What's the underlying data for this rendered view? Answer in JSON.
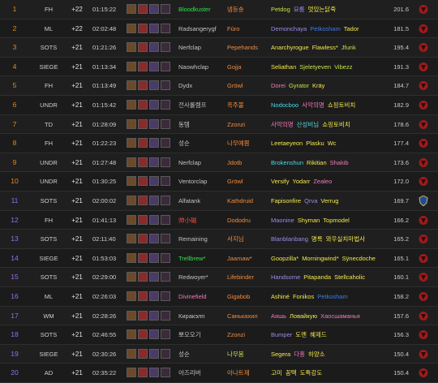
{
  "board": {
    "rows": [
      {
        "rank": "1",
        "rank_color": "#e78a1f",
        "dungeon": "FH",
        "level": "+22",
        "time": "01:15:22",
        "players": [
          {
            "name": "Bloodkuster",
            "color": "#2ee34b"
          },
          {
            "name": "넴등송",
            "color": "#f28a3c"
          },
          {
            "name": "Petdog",
            "color": "#c2e24a"
          },
          {
            "name": "묘룸",
            "color": "#9c8bea"
          },
          {
            "name": "멋있는닭죽",
            "color": "#f3e84a"
          }
        ],
        "score": "201.6",
        "faction": "horde"
      },
      {
        "rank": "2",
        "rank_color": "#e78a1f",
        "dungeon": "ML",
        "level": "+22",
        "time": "02:02:48",
        "players": [
          {
            "name": "Radsangerygf",
            "color": "#c2c2c2"
          },
          {
            "name": "Fúro",
            "color": "#f28a3c"
          },
          {
            "name": "Demonchaya",
            "color": "#9c8bea"
          },
          {
            "name": "Petkosham",
            "color": "#3d7be8"
          },
          {
            "name": "Tador",
            "color": "#f3e84a"
          }
        ],
        "score": "181.5",
        "faction": "horde"
      },
      {
        "rank": "3",
        "rank_color": "#e78a1f",
        "dungeon": "SOTS",
        "level": "+21",
        "time": "01:21:26",
        "players": [
          {
            "name": "Nerfclap",
            "color": "#c2c2c2"
          },
          {
            "name": "Pepehands",
            "color": "#f28a3c"
          },
          {
            "name": "Anarchyrogue",
            "color": "#f3e84a"
          },
          {
            "name": "Flawless*",
            "color": "#f3e84a"
          },
          {
            "name": "Jfunk",
            "color": "#c2e24a"
          }
        ],
        "score": "195.4",
        "faction": "horde"
      },
      {
        "rank": "4",
        "rank_color": "#e78a1f",
        "dungeon": "SIEGE",
        "level": "+21",
        "time": "01:13:34",
        "players": [
          {
            "name": "Naowhclap",
            "color": "#c2c2c2"
          },
          {
            "name": "Gojja",
            "color": "#f28a3c"
          },
          {
            "name": "Seliathan",
            "color": "#f3e84a"
          },
          {
            "name": "Sjeletyeven",
            "color": "#c2e24a"
          },
          {
            "name": "Vibezz",
            "color": "#c2e24a"
          }
        ],
        "score": "191.3",
        "faction": "horde"
      },
      {
        "rank": "5",
        "rank_color": "#e78a1f",
        "dungeon": "FH",
        "level": "+21",
        "time": "01:13:49",
        "players": [
          {
            "name": "Dydx",
            "color": "#c2c2c2"
          },
          {
            "name": "Gröwl",
            "color": "#f28a3c"
          },
          {
            "name": "Dorei",
            "color": "#f07ab8"
          },
          {
            "name": "Gyrator",
            "color": "#c2e24a"
          },
          {
            "name": "Kräy",
            "color": "#f3e84a"
          }
        ],
        "score": "184.7",
        "faction": "horde"
      },
      {
        "rank": "6",
        "rank_color": "#e78a1f",
        "dungeon": "UNDR",
        "level": "+21",
        "time": "01:15:42",
        "players": [
          {
            "name": "전사롤렘프",
            "color": "#c2c2c2"
          },
          {
            "name": "흑주볼",
            "color": "#f28a3c"
          },
          {
            "name": "Nodocboo",
            "color": "#4ad8e8"
          },
          {
            "name": "사악의명",
            "color": "#f07ab8"
          },
          {
            "name": "쇼핑토비치",
            "color": "#f3e84a"
          }
        ],
        "score": "182.9",
        "faction": "horde"
      },
      {
        "rank": "7",
        "rank_color": "#e78a1f",
        "dungeon": "TD",
        "level": "+21",
        "time": "01:28:09",
        "players": [
          {
            "name": "동템",
            "color": "#c2c2c2"
          },
          {
            "name": "Zzonzi",
            "color": "#f28a3c"
          },
          {
            "name": "사악의명",
            "color": "#f07ab8"
          },
          {
            "name": "산성비님",
            "color": "#4ad8e8"
          },
          {
            "name": "쇼핑토비치",
            "color": "#f3e84a"
          }
        ],
        "score": "178.6",
        "faction": "horde"
      },
      {
        "rank": "8",
        "rank_color": "#e78a1f",
        "dungeon": "FH",
        "level": "+21",
        "time": "01:22:23",
        "players": [
          {
            "name": "성순",
            "color": "#c2c2c2"
          },
          {
            "name": "나무예쁨",
            "color": "#f28a3c"
          },
          {
            "name": "Leetaeyeon",
            "color": "#f3e84a"
          },
          {
            "name": "Plasku",
            "color": "#f3e84a"
          },
          {
            "name": "Wc",
            "color": "#f3e84a"
          }
        ],
        "score": "177.4",
        "faction": "horde"
      },
      {
        "rank": "9",
        "rank_color": "#e78a1f",
        "dungeon": "UNDR",
        "level": "+21",
        "time": "01:27:48",
        "players": [
          {
            "name": "Nerfclap",
            "color": "#c2c2c2"
          },
          {
            "name": "Jdotb",
            "color": "#f28a3c"
          },
          {
            "name": "Brokenshun",
            "color": "#4ad8e8"
          },
          {
            "name": "Rikitian",
            "color": "#f3e84a"
          },
          {
            "name": "Shakib",
            "color": "#f07ab8"
          }
        ],
        "score": "173.6",
        "faction": "horde"
      },
      {
        "rank": "10",
        "rank_color": "#e78a1f",
        "dungeon": "UNDR",
        "level": "+21",
        "time": "01:30:25",
        "players": [
          {
            "name": "Ventorclap",
            "color": "#c2c2c2"
          },
          {
            "name": "Gröwl",
            "color": "#f28a3c"
          },
          {
            "name": "Versify",
            "color": "#f3e84a"
          },
          {
            "name": "Yodarr",
            "color": "#f3e84a"
          },
          {
            "name": "Zealeo",
            "color": "#f07ab8"
          }
        ],
        "score": "172.0",
        "faction": "horde"
      },
      {
        "rank": "11",
        "rank_color": "#9a6cf0",
        "dungeon": "SOTS",
        "level": "+21",
        "time": "02:00:02",
        "players": [
          {
            "name": "Alfatank",
            "color": "#c2c2c2"
          },
          {
            "name": "Kathdruid",
            "color": "#f28a3c"
          },
          {
            "name": "Fapisonfire",
            "color": "#f3e84a"
          },
          {
            "name": "Qrva",
            "color": "#9c8bea"
          },
          {
            "name": "Verrug",
            "color": "#f3e84a"
          }
        ],
        "score": "169.7",
        "faction": "alliance"
      },
      {
        "rank": "12",
        "rank_color": "#9a6cf0",
        "dungeon": "FH",
        "level": "+21",
        "time": "01:41:13",
        "players": [
          {
            "name": "帅小磁",
            "color": "#f05050"
          },
          {
            "name": "Dododru",
            "color": "#f28a3c"
          },
          {
            "name": "Maonine",
            "color": "#9c8bea"
          },
          {
            "name": "Shyman",
            "color": "#f3e84a"
          },
          {
            "name": "Topmodel",
            "color": "#f3e84a"
          }
        ],
        "score": "166.2",
        "faction": "horde"
      },
      {
        "rank": "13",
        "rank_color": "#9a6cf0",
        "dungeon": "SOTS",
        "level": "+21",
        "time": "02:11:40",
        "players": [
          {
            "name": "Remaining",
            "color": "#c2c2c2"
          },
          {
            "name": "서지님",
            "color": "#f28a3c"
          },
          {
            "name": "Blanblanbang",
            "color": "#9c8bea"
          },
          {
            "name": "명록",
            "color": "#f3e84a"
          },
          {
            "name": "와우실치마법사",
            "color": "#f3e84a"
          }
        ],
        "score": "165.2",
        "faction": "horde"
      },
      {
        "rank": "14",
        "rank_color": "#9a6cf0",
        "dungeon": "SIEGE",
        "level": "+21",
        "time": "01:53:03",
        "players": [
          {
            "name": "Trellbrew*",
            "color": "#2ee34b"
          },
          {
            "name": "Jaamaw*",
            "color": "#f28a3c"
          },
          {
            "name": "Goopzilla*",
            "color": "#f3e84a"
          },
          {
            "name": "Morningwind*",
            "color": "#f3e84a"
          },
          {
            "name": "Sÿnecdoche",
            "color": "#f3e84a"
          }
        ],
        "score": "165.1",
        "faction": "horde"
      },
      {
        "rank": "15",
        "rank_color": "#9a6cf0",
        "dungeon": "SOTS",
        "level": "+21",
        "time": "02:29:00",
        "players": [
          {
            "name": "Redwoyer*",
            "color": "#c2c2c2"
          },
          {
            "name": "Lifebinder",
            "color": "#f28a3c"
          },
          {
            "name": "Handsome",
            "color": "#9c8bea"
          },
          {
            "name": "Pitapanda",
            "color": "#f3e84a"
          },
          {
            "name": "Stellcaholic",
            "color": "#f3e84a"
          }
        ],
        "score": "160.1",
        "faction": "horde"
      },
      {
        "rank": "16",
        "rank_color": "#9a6cf0",
        "dungeon": "ML",
        "level": "+21",
        "time": "02:26:03",
        "players": [
          {
            "name": "Divinefield",
            "color": "#f07ab8"
          },
          {
            "name": "Gigabob",
            "color": "#f28a3c"
          },
          {
            "name": "Ashiné",
            "color": "#f3e84a"
          },
          {
            "name": "Fonikos",
            "color": "#f3e84a"
          },
          {
            "name": "Petkosham",
            "color": "#3d7be8"
          }
        ],
        "score": "158.2",
        "faction": "horde"
      },
      {
        "rank": "17",
        "rank_color": "#9a6cf0",
        "dungeon": "WM",
        "level": "+21",
        "time": "02:28:26",
        "players": [
          {
            "name": "Киракэлп",
            "color": "#c2c2c2"
          },
          {
            "name": "Санькахил",
            "color": "#f28a3c"
          },
          {
            "name": "Аяшь",
            "color": "#f07ab8"
          },
          {
            "name": "Ловайкую",
            "color": "#f3e84a"
          },
          {
            "name": "Хаосшаманья",
            "color": "#f07ab8"
          }
        ],
        "score": "157.6",
        "faction": "horde"
      },
      {
        "rank": "18",
        "rank_color": "#9a6cf0",
        "dungeon": "SOTS",
        "level": "+21",
        "time": "02:46:55",
        "players": [
          {
            "name": "뽀오오기",
            "color": "#c2c2c2"
          },
          {
            "name": "Zzonzi",
            "color": "#f28a3c"
          },
          {
            "name": "Bumper",
            "color": "#9c8bea"
          },
          {
            "name": "도멘",
            "color": "#f3e84a"
          },
          {
            "name": "혜제드",
            "color": "#f3e84a"
          }
        ],
        "score": "156.3",
        "faction": "horde"
      },
      {
        "rank": "19",
        "rank_color": "#9a6cf0",
        "dungeon": "SIEGE",
        "level": "+21",
        "time": "02:30:26",
        "players": [
          {
            "name": "성순",
            "color": "#c2c2c2"
          },
          {
            "name": "나무봄",
            "color": "#c2e24a"
          },
          {
            "name": "Segera",
            "color": "#f3e84a"
          },
          {
            "name": "다홍",
            "color": "#f07ab8"
          },
          {
            "name": "하양소",
            "color": "#f3e84a"
          }
        ],
        "score": "150.4",
        "faction": "horde"
      },
      {
        "rank": "20",
        "rank_color": "#9a6cf0",
        "dungeon": "AD",
        "level": "+21",
        "time": "02:35:22",
        "players": [
          {
            "name": "아즈리버",
            "color": "#c2c2c2"
          },
          {
            "name": "아나트제",
            "color": "#f28a3c"
          },
          {
            "name": "고미",
            "color": "#f3e84a"
          },
          {
            "name": "꽁택",
            "color": "#f3e84a"
          },
          {
            "name": "도특강도",
            "color": "#f3e84a"
          }
        ],
        "score": "150.4",
        "faction": "horde"
      }
    ]
  },
  "affix_icons": [
    "fortified-icon",
    "bursting-icon",
    "skittish-icon",
    "infested-icon"
  ],
  "colors": {
    "horde": "#9b1c1c",
    "alliance": "#1e4c9a"
  }
}
